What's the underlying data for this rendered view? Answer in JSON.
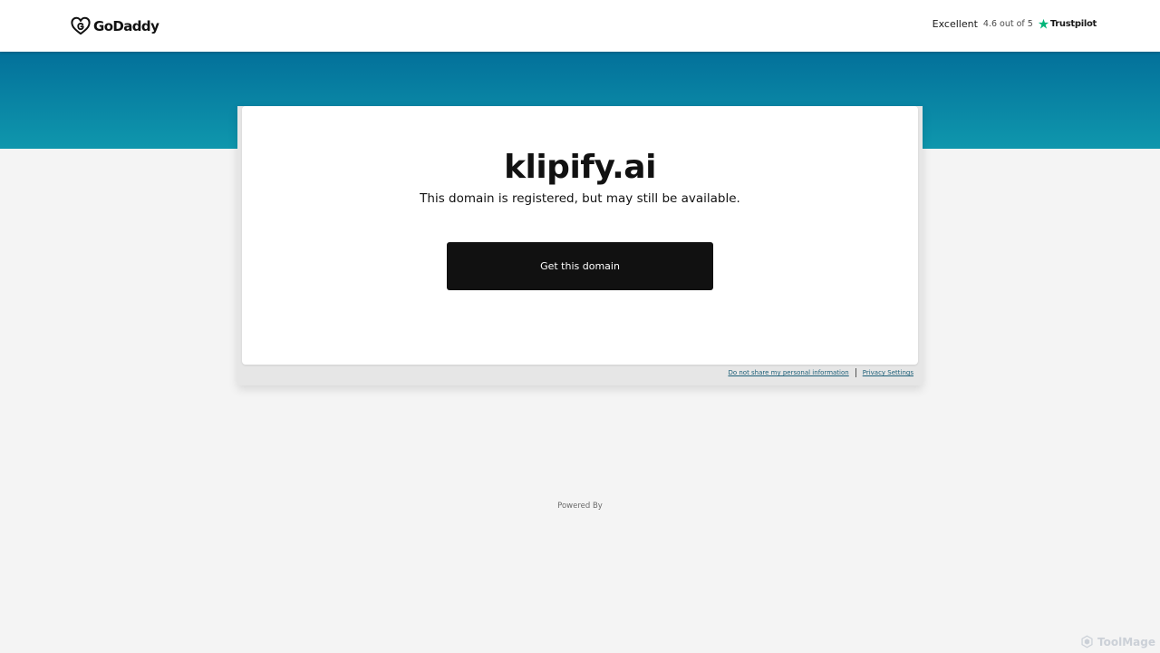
{
  "header": {
    "logo_text": "GoDaddy",
    "trustpilot": {
      "rating_label": "Excellent",
      "score_text": "4.6 out of 5",
      "brand": "Trustpilot",
      "star_color": "#00b67a"
    }
  },
  "main": {
    "domain": "klipify.ai",
    "subtitle": "This domain is registered, but may still be available.",
    "cta_label": "Get this domain"
  },
  "footer": {
    "links": [
      "Do not share my personal information",
      "Privacy Settings"
    ],
    "powered_by": "Powered By"
  },
  "watermark": {
    "text": "ToolMage"
  },
  "colors": {
    "banner_top": "#03709a",
    "banner_bottom": "#0f97ad",
    "cta_background": "#111111",
    "page_background": "#f4f4f4"
  }
}
